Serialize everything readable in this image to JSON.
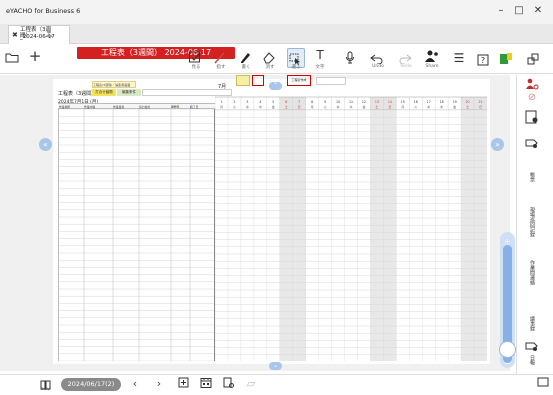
{
  "app": {
    "title": "eYACHO for Business 6"
  },
  "window": {
    "minimize": "–",
    "maximize": "□",
    "close": "✕"
  },
  "tab": {
    "title": "工程表（3週間）",
    "date": "_2024-06-17",
    "close": "✖"
  },
  "toolbar": {
    "document_title": "工程表（3週間） 2024-06-17",
    "tools": [
      {
        "label": "見る",
        "icon": "view-icon"
      },
      {
        "label": "指す",
        "icon": "pointer-icon"
      },
      {
        "label": "書く",
        "icon": "pen-icon"
      },
      {
        "label": "消す",
        "icon": "eraser-icon"
      },
      {
        "label": "選ぶ",
        "icon": "select-icon"
      },
      {
        "label": "文字",
        "icon": "text-icon"
      },
      {
        "label": "Undo",
        "icon": "undo-icon"
      },
      {
        "label": "Redo",
        "icon": "redo-icon"
      },
      {
        "label": "Share",
        "icon": "share-icon"
      }
    ]
  },
  "sheet": {
    "header_note": "工程表(3週間)・編集用画面",
    "title": "工程表（3週間）",
    "tag_a": "打合せ議題",
    "tag_b": "編集条件",
    "date": "2024年7月1日 (月)",
    "columns": [
      "作業場所",
      "作業内容",
      "作業業者",
      "協力会社",
      "開始日",
      "終了日"
    ],
    "days": [
      "1",
      "2",
      "3",
      "4",
      "5",
      "6",
      "7",
      "8",
      "9",
      "10",
      "11",
      "12",
      "13",
      "14",
      "15",
      "16",
      "17",
      "18",
      "19",
      "20",
      "21"
    ],
    "weekdays": [
      "月",
      "火",
      "水",
      "木",
      "金",
      "土",
      "日",
      "月",
      "火",
      "水",
      "木",
      "金",
      "土",
      "日",
      "月",
      "火",
      "水",
      "木",
      "金",
      "土",
      "日"
    ],
    "month_label": "7月",
    "red_box_2_text": "工程表作成"
  },
  "right_panel": {
    "labels": [
      "帳票",
      "現場巡回記録",
      "作業間連絡",
      "議事録",
      "日報"
    ]
  },
  "bottom": {
    "date_pill": "2024/06/17(2)",
    "daily_label": "Daily"
  },
  "colors": {
    "accent_red": "#d32020",
    "highlight_yellow": "#f2e35a",
    "nav_blue": "#a9c5ea",
    "slider_blue": "#87b1e6"
  }
}
